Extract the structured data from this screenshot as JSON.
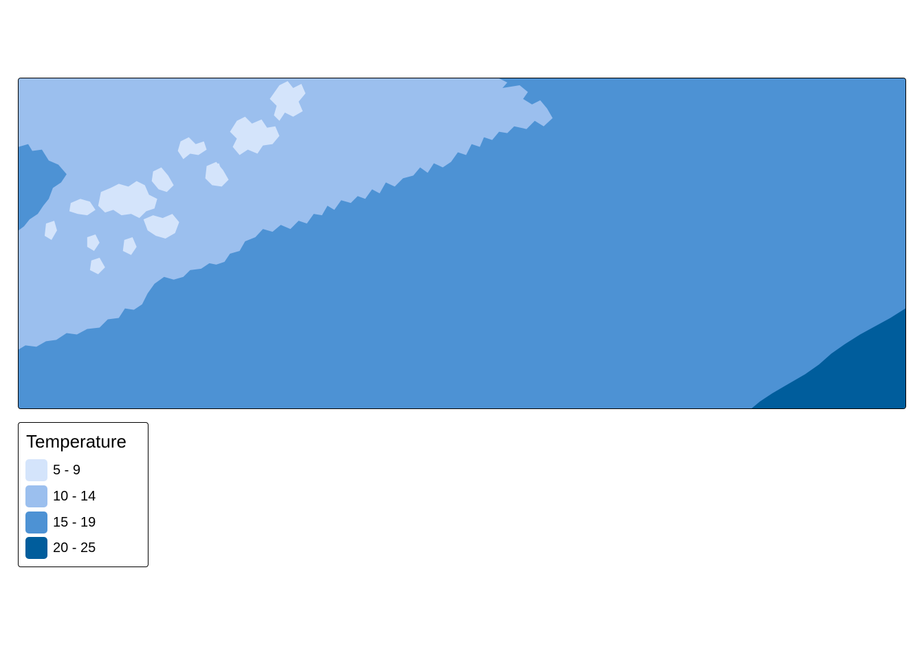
{
  "legend": {
    "title": "Temperature",
    "classes": [
      {
        "label": "5 - 9",
        "color": "#d4e4fb"
      },
      {
        "label": "10 - 14",
        "color": "#9bbfee"
      },
      {
        "label": "15 - 19",
        "color": "#4d92d4"
      },
      {
        "label": "20 - 25",
        "color": "#005d9c"
      }
    ]
  }
}
